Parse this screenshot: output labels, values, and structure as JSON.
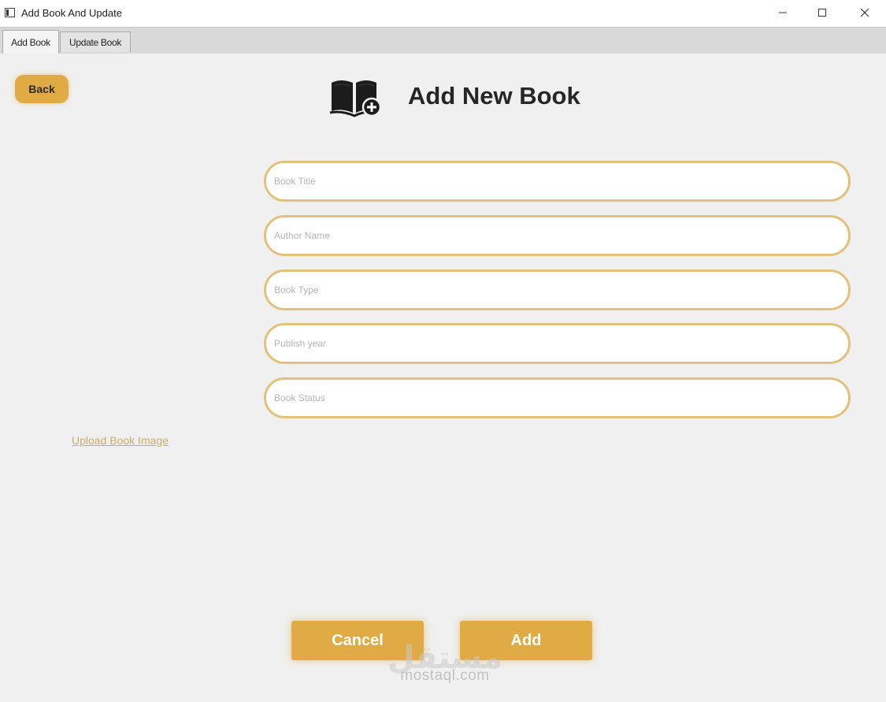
{
  "window": {
    "title": "Add Book And Update",
    "minimize_icon": "minimize-icon",
    "maximize_icon": "maximize-icon",
    "close_icon": "close-icon"
  },
  "tabs": [
    {
      "label": "Add Book",
      "active": true
    },
    {
      "label": "Update Book",
      "active": false
    }
  ],
  "back_button": {
    "label": "Back"
  },
  "header": {
    "icon": "book-add-icon",
    "title": "Add New Book"
  },
  "form": {
    "fields": [
      {
        "name": "book-title",
        "placeholder": "Book Title",
        "value": ""
      },
      {
        "name": "author-name",
        "placeholder": "Author Name",
        "value": ""
      },
      {
        "name": "book-type",
        "placeholder": "Book Type",
        "value": ""
      },
      {
        "name": "publish-year",
        "placeholder": "Publish year",
        "value": ""
      },
      {
        "name": "book-status",
        "placeholder": "Book Status",
        "value": ""
      }
    ]
  },
  "upload_link": {
    "label": "Upload Book Image"
  },
  "buttons": {
    "cancel_label": "Cancel",
    "add_label": "Add"
  },
  "watermark": {
    "arabic": "مستقل",
    "latin": "mostaql.com"
  },
  "colors": {
    "accent": "#e0ab45",
    "field_border": "#e2c27a",
    "background": "#f0f0f0"
  }
}
